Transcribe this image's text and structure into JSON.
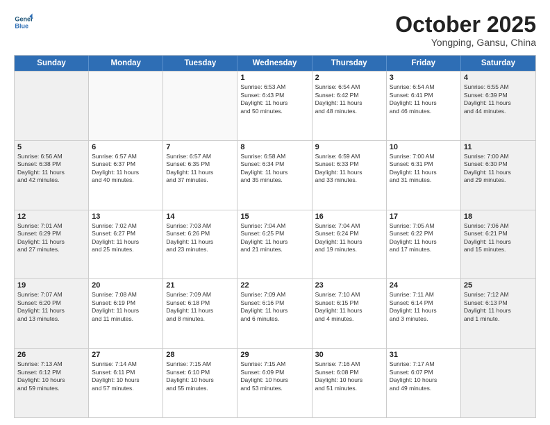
{
  "header": {
    "logo_line1": "General",
    "logo_line2": "Blue",
    "month": "October 2025",
    "location": "Yongping, Gansu, China"
  },
  "days_of_week": [
    "Sunday",
    "Monday",
    "Tuesday",
    "Wednesday",
    "Thursday",
    "Friday",
    "Saturday"
  ],
  "weeks": [
    [
      {
        "day": "",
        "info": ""
      },
      {
        "day": "",
        "info": ""
      },
      {
        "day": "",
        "info": ""
      },
      {
        "day": "1",
        "info": "Sunrise: 6:53 AM\nSunset: 6:43 PM\nDaylight: 11 hours\nand 50 minutes."
      },
      {
        "day": "2",
        "info": "Sunrise: 6:54 AM\nSunset: 6:42 PM\nDaylight: 11 hours\nand 48 minutes."
      },
      {
        "day": "3",
        "info": "Sunrise: 6:54 AM\nSunset: 6:41 PM\nDaylight: 11 hours\nand 46 minutes."
      },
      {
        "day": "4",
        "info": "Sunrise: 6:55 AM\nSunset: 6:39 PM\nDaylight: 11 hours\nand 44 minutes."
      }
    ],
    [
      {
        "day": "5",
        "info": "Sunrise: 6:56 AM\nSunset: 6:38 PM\nDaylight: 11 hours\nand 42 minutes."
      },
      {
        "day": "6",
        "info": "Sunrise: 6:57 AM\nSunset: 6:37 PM\nDaylight: 11 hours\nand 40 minutes."
      },
      {
        "day": "7",
        "info": "Sunrise: 6:57 AM\nSunset: 6:35 PM\nDaylight: 11 hours\nand 37 minutes."
      },
      {
        "day": "8",
        "info": "Sunrise: 6:58 AM\nSunset: 6:34 PM\nDaylight: 11 hours\nand 35 minutes."
      },
      {
        "day": "9",
        "info": "Sunrise: 6:59 AM\nSunset: 6:33 PM\nDaylight: 11 hours\nand 33 minutes."
      },
      {
        "day": "10",
        "info": "Sunrise: 7:00 AM\nSunset: 6:31 PM\nDaylight: 11 hours\nand 31 minutes."
      },
      {
        "day": "11",
        "info": "Sunrise: 7:00 AM\nSunset: 6:30 PM\nDaylight: 11 hours\nand 29 minutes."
      }
    ],
    [
      {
        "day": "12",
        "info": "Sunrise: 7:01 AM\nSunset: 6:29 PM\nDaylight: 11 hours\nand 27 minutes."
      },
      {
        "day": "13",
        "info": "Sunrise: 7:02 AM\nSunset: 6:27 PM\nDaylight: 11 hours\nand 25 minutes."
      },
      {
        "day": "14",
        "info": "Sunrise: 7:03 AM\nSunset: 6:26 PM\nDaylight: 11 hours\nand 23 minutes."
      },
      {
        "day": "15",
        "info": "Sunrise: 7:04 AM\nSunset: 6:25 PM\nDaylight: 11 hours\nand 21 minutes."
      },
      {
        "day": "16",
        "info": "Sunrise: 7:04 AM\nSunset: 6:24 PM\nDaylight: 11 hours\nand 19 minutes."
      },
      {
        "day": "17",
        "info": "Sunrise: 7:05 AM\nSunset: 6:22 PM\nDaylight: 11 hours\nand 17 minutes."
      },
      {
        "day": "18",
        "info": "Sunrise: 7:06 AM\nSunset: 6:21 PM\nDaylight: 11 hours\nand 15 minutes."
      }
    ],
    [
      {
        "day": "19",
        "info": "Sunrise: 7:07 AM\nSunset: 6:20 PM\nDaylight: 11 hours\nand 13 minutes."
      },
      {
        "day": "20",
        "info": "Sunrise: 7:08 AM\nSunset: 6:19 PM\nDaylight: 11 hours\nand 11 minutes."
      },
      {
        "day": "21",
        "info": "Sunrise: 7:09 AM\nSunset: 6:18 PM\nDaylight: 11 hours\nand 8 minutes."
      },
      {
        "day": "22",
        "info": "Sunrise: 7:09 AM\nSunset: 6:16 PM\nDaylight: 11 hours\nand 6 minutes."
      },
      {
        "day": "23",
        "info": "Sunrise: 7:10 AM\nSunset: 6:15 PM\nDaylight: 11 hours\nand 4 minutes."
      },
      {
        "day": "24",
        "info": "Sunrise: 7:11 AM\nSunset: 6:14 PM\nDaylight: 11 hours\nand 3 minutes."
      },
      {
        "day": "25",
        "info": "Sunrise: 7:12 AM\nSunset: 6:13 PM\nDaylight: 11 hours\nand 1 minute."
      }
    ],
    [
      {
        "day": "26",
        "info": "Sunrise: 7:13 AM\nSunset: 6:12 PM\nDaylight: 10 hours\nand 59 minutes."
      },
      {
        "day": "27",
        "info": "Sunrise: 7:14 AM\nSunset: 6:11 PM\nDaylight: 10 hours\nand 57 minutes."
      },
      {
        "day": "28",
        "info": "Sunrise: 7:15 AM\nSunset: 6:10 PM\nDaylight: 10 hours\nand 55 minutes."
      },
      {
        "day": "29",
        "info": "Sunrise: 7:15 AM\nSunset: 6:09 PM\nDaylight: 10 hours\nand 53 minutes."
      },
      {
        "day": "30",
        "info": "Sunrise: 7:16 AM\nSunset: 6:08 PM\nDaylight: 10 hours\nand 51 minutes."
      },
      {
        "day": "31",
        "info": "Sunrise: 7:17 AM\nSunset: 6:07 PM\nDaylight: 10 hours\nand 49 minutes."
      },
      {
        "day": "",
        "info": ""
      }
    ]
  ]
}
